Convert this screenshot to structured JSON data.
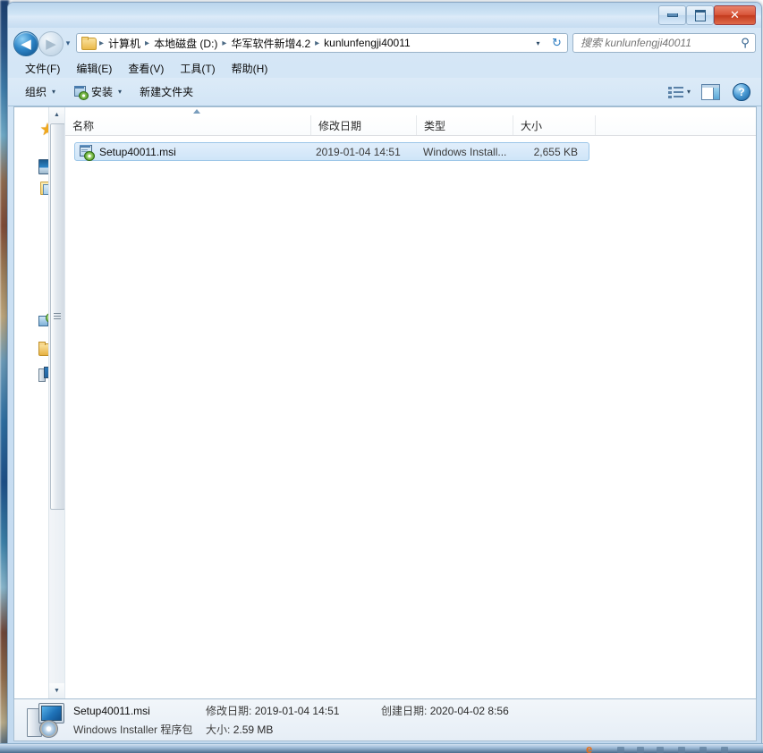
{
  "window": {
    "title_blurred": " ",
    "buttons": {
      "minimize": "minimize-button",
      "maximize": "maximize-button",
      "close": "✕"
    }
  },
  "address": {
    "back_glyph": "◀",
    "forward_glyph": "▶",
    "recent_glyph": "▾",
    "dropdown_glyph": "▾",
    "refresh_glyph": "↻",
    "separator": "▸",
    "crumbs": [
      {
        "label": "计算机"
      },
      {
        "label": "本地磁盘 (D:)"
      },
      {
        "label": "华军软件新增4.2"
      },
      {
        "label": "kunlunfengji40011"
      }
    ]
  },
  "search": {
    "placeholder": "搜索 kunlunfengji40011",
    "value": "",
    "icon_glyph": "⚲"
  },
  "menu": {
    "items": [
      {
        "label": "文件(F)"
      },
      {
        "label": "编辑(E)"
      },
      {
        "label": "查看(V)"
      },
      {
        "label": "工具(T)"
      },
      {
        "label": "帮助(H)"
      }
    ]
  },
  "toolbar": {
    "organize_label": "组织",
    "install_label": "安装",
    "new_folder_label": "新建文件夹",
    "caret_glyph": "▾",
    "help_glyph": "?"
  },
  "file_list": {
    "columns": [
      {
        "label": "名称"
      },
      {
        "label": "修改日期"
      },
      {
        "label": "类型"
      },
      {
        "label": "大小"
      }
    ],
    "rows": [
      {
        "name": "Setup40011.msi",
        "date_modified": "2019-01-04 14:51",
        "type": "Windows Install...",
        "size": "2,655 KB",
        "selected": true
      }
    ]
  },
  "details_pane": {
    "file_name": "Setup40011.msi",
    "file_type": "Windows Installer 程序包",
    "modified_label": "修改日期:",
    "modified_value": "2019-01-04 14:51",
    "size_label": "大小:",
    "size_value": "2.59 MB",
    "created_label": "创建日期:",
    "created_value": "2020-04-02 8:56"
  },
  "taskbar": {
    "ie_icon_glyph": "e"
  },
  "colors": {
    "selection_fill": "#cfe5f8",
    "selection_border": "#9cc6e8",
    "close_button": "#c33a1d",
    "accent": "#2e86c8"
  }
}
